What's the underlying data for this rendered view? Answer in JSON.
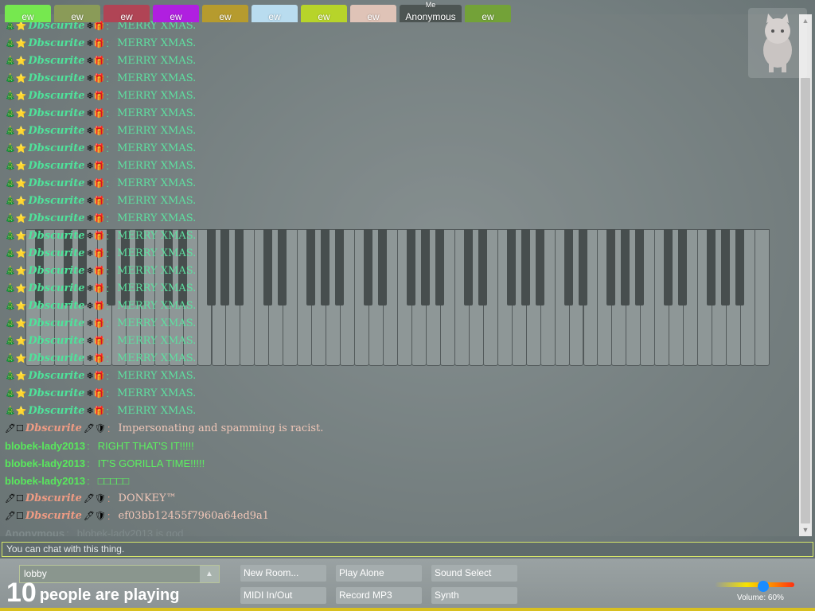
{
  "tabs": [
    {
      "label": "ew",
      "color": "#76e84f"
    },
    {
      "label": "ew",
      "color": "#8a9b58"
    },
    {
      "label": "ew",
      "color": "#b04455"
    },
    {
      "label": "ew",
      "color": "#b01fe0"
    },
    {
      "label": "ew",
      "color": "#b69b2e"
    },
    {
      "label": "ew",
      "color": "#b9dcef"
    },
    {
      "label": "ew",
      "color": "#b7d42a"
    },
    {
      "label": "ew",
      "color": "#dfc3b7"
    },
    {
      "label": "Anonymous",
      "me": "Me",
      "color": "#4d5553"
    },
    {
      "label": "ew",
      "color": "#73a238"
    }
  ],
  "chat": {
    "messages": [
      {
        "icons": "🎄⭐",
        "nick": "Dbscurite",
        "suffix": "❄🎁",
        "text": "MERRY XMAS.",
        "nick_color": "#4ee39a",
        "text_color": "#5de0a0"
      },
      {
        "icons": "🎄⭐",
        "nick": "Dbscurite",
        "suffix": "❄🎁",
        "text": "MERRY XMAS.",
        "nick_color": "#4ee39a",
        "text_color": "#5de0a0"
      },
      {
        "icons": "🎄⭐",
        "nick": "Dbscurite",
        "suffix": "❄🎁",
        "text": "MERRY XMAS.",
        "nick_color": "#4ee39a",
        "text_color": "#5de0a0"
      },
      {
        "icons": "🎄⭐",
        "nick": "Dbscurite",
        "suffix": "❄🎁",
        "text": "MERRY XMAS.",
        "nick_color": "#4ee39a",
        "text_color": "#5de0a0"
      },
      {
        "icons": "🎄⭐",
        "nick": "Dbscurite",
        "suffix": "❄🎁",
        "text": "MERRY XMAS.",
        "nick_color": "#4ee39a",
        "text_color": "#5de0a0"
      },
      {
        "icons": "🎄⭐",
        "nick": "Dbscurite",
        "suffix": "❄🎁",
        "text": "MERRY XMAS.",
        "nick_color": "#4ee39a",
        "text_color": "#5de0a0"
      },
      {
        "icons": "🎄⭐",
        "nick": "Dbscurite",
        "suffix": "❄🎁",
        "text": "MERRY XMAS.",
        "nick_color": "#4ee39a",
        "text_color": "#5de0a0"
      },
      {
        "icons": "🎄⭐",
        "nick": "Dbscurite",
        "suffix": "❄🎁",
        "text": "MERRY XMAS.",
        "nick_color": "#4ee39a",
        "text_color": "#5de0a0"
      },
      {
        "icons": "🎄⭐",
        "nick": "Dbscurite",
        "suffix": "❄🎁",
        "text": "MERRY XMAS.",
        "nick_color": "#4ee39a",
        "text_color": "#5de0a0"
      },
      {
        "icons": "🎄⭐",
        "nick": "Dbscurite",
        "suffix": "❄🎁",
        "text": "MERRY XMAS.",
        "nick_color": "#4ee39a",
        "text_color": "#5de0a0"
      },
      {
        "icons": "🎄⭐",
        "nick": "Dbscurite",
        "suffix": "❄🎁",
        "text": "MERRY XMAS.",
        "nick_color": "#4ee39a",
        "text_color": "#5de0a0"
      },
      {
        "icons": "🎄⭐",
        "nick": "Dbscurite",
        "suffix": "❄🎁",
        "text": "MERRY XMAS.",
        "nick_color": "#4ee39a",
        "text_color": "#5de0a0"
      },
      {
        "icons": "🎄⭐",
        "nick": "Dbscurite",
        "suffix": "❄🎁",
        "text": "MERRY XMAS.",
        "nick_color": "#4ee39a",
        "text_color": "#5de0a0"
      },
      {
        "icons": "🎄⭐",
        "nick": "Dbscurite",
        "suffix": "❄🎁",
        "text": "MERRY XMAS.",
        "nick_color": "#4ee39a",
        "text_color": "#5de0a0"
      },
      {
        "icons": "🎄⭐",
        "nick": "Dbscurite",
        "suffix": "❄🎁",
        "text": "MERRY XMAS.",
        "nick_color": "#4ee39a",
        "text_color": "#5de0a0"
      },
      {
        "icons": "🎄⭐",
        "nick": "Dbscurite",
        "suffix": "❄🎁",
        "text": "MERRY XMAS.",
        "nick_color": "#4ee39a",
        "text_color": "#5de0a0"
      },
      {
        "icons": "🎄⭐",
        "nick": "Dbscurite",
        "suffix": "❄🎁",
        "text": "MERRY XMAS.",
        "nick_color": "#4ee39a",
        "text_color": "#5de0a0"
      },
      {
        "icons": "🎄⭐",
        "nick": "Dbscurite",
        "suffix": "❄🎁",
        "text": "MERRY XMAS.",
        "nick_color": "#4ee39a",
        "text_color": "#5de0a0"
      },
      {
        "icons": "🎄⭐",
        "nick": "Dbscurite",
        "suffix": "❄🎁",
        "text": "MERRY XMAS.",
        "nick_color": "#4ee39a",
        "text_color": "#5de0a0"
      },
      {
        "icons": "🎄⭐",
        "nick": "Dbscurite",
        "suffix": "❄🎁",
        "text": "MERRY XMAS.",
        "nick_color": "#4ee39a",
        "text_color": "#5de0a0"
      },
      {
        "icons": "🎄⭐",
        "nick": "Dbscurite",
        "suffix": "❄🎁",
        "text": "MERRY XMAS.",
        "nick_color": "#4ee39a",
        "text_color": "#5de0a0"
      },
      {
        "icons": "🎄⭐",
        "nick": "Dbscurite",
        "suffix": "❄🎁",
        "text": "MERRY XMAS.",
        "nick_color": "#4ee39a",
        "text_color": "#5de0a0"
      },
      {
        "icons": "🎄⭐",
        "nick": "Dbscurite",
        "suffix": "❄🎁",
        "text": "MERRY XMAS.",
        "nick_color": "#4ee39a",
        "text_color": "#5de0a0"
      },
      {
        "icons": "🖊☐",
        "nick": "Dbscurite",
        "suffix": "🖊🛡",
        "text": "Impersonating and spamming is racist.",
        "nick_color": "#ef9b83",
        "text_color": "#f2c7b8"
      },
      {
        "icons": "",
        "nick": "blobek-lady2013",
        "suffix": "",
        "text": "RIGHT THAT'S IT!!!!!",
        "nick_color": "#58e85c",
        "text_color": "#5cf060",
        "plain": true
      },
      {
        "icons": "",
        "nick": "blobek-lady2013",
        "suffix": "",
        "text": "IT'S GORILLA TIME!!!!!",
        "nick_color": "#58e85c",
        "text_color": "#5cf060",
        "plain": true
      },
      {
        "icons": "",
        "nick": "blobek-lady2013",
        "suffix": "",
        "text": "□□□□□",
        "nick_color": "#58e85c",
        "text_color": "#5cf060",
        "plain": true
      },
      {
        "icons": "🖊☐",
        "nick": "Dbscurite",
        "suffix": "🖊🛡",
        "text": "DONKEY™",
        "nick_color": "#ef9b83",
        "text_color": "#f2c7b8"
      },
      {
        "icons": "🖊☐",
        "nick": "Dbscurite",
        "suffix": "🖊🛡",
        "text": "ef03bb12455f7960a64ed9a1",
        "nick_color": "#ef9b83",
        "text_color": "#f2c7b8"
      },
      {
        "icons": "",
        "nick": "Anonymous",
        "suffix": "",
        "text": "blobek-lady2013 is god",
        "nick_color": "#7f8a8b",
        "text_color": "#7f8a8b",
        "plain": true
      }
    ],
    "input_placeholder": "You can chat with this thing."
  },
  "room": {
    "name": "lobby"
  },
  "players": {
    "count": "10",
    "label": "people are playing"
  },
  "buttons": {
    "new_room": "New Room...",
    "play_alone": "Play Alone",
    "sound_select": "Sound Select",
    "midi": "MIDI In/Out",
    "record": "Record MP3",
    "synth": "Synth"
  },
  "volume": {
    "label": "Volume: 60%",
    "level": 0.6
  }
}
